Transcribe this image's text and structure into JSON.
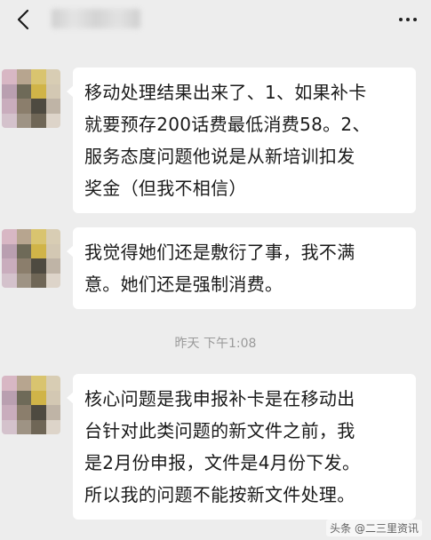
{
  "header": {
    "back_icon": "chevron-left-icon",
    "more_icon": "more-horizontal-icon"
  },
  "messages": [
    {
      "lines": [
        "移动处理结果出来了、1、如果补卡",
        "就要预存200话费最低消费58。2、",
        "服务态度问题他说是从新培训扣发",
        "奖金（但我不相信）"
      ]
    },
    {
      "lines": [
        "我觉得她们还是敷衍了事，我不满",
        "意。她们还是强制消费。"
      ]
    },
    {
      "lines": [
        "核心问题是我申报补卡是在移动出",
        "台针对此类问题的新文件之前，我",
        "是2月份申报，文件是4月份下发。",
        "所以我的问题不能按新文件处理。"
      ]
    }
  ],
  "timestamp": "昨天 下午1:08",
  "watermark": "头条 @二三里资讯",
  "colors": {
    "background": "#ededed",
    "bubble": "#ffffff",
    "timestamp": "#9a9a9a"
  }
}
